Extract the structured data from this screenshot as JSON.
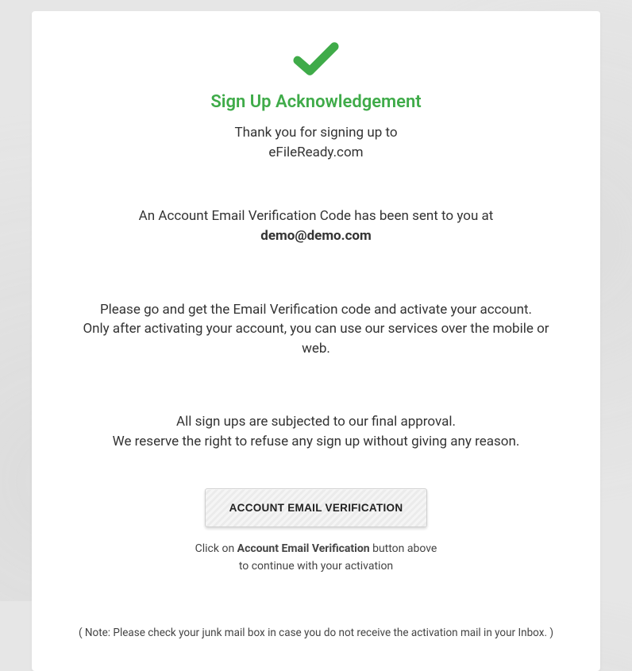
{
  "title": "Sign Up Acknowledgement",
  "subtitle_line1": "Thank you for signing up to",
  "subtitle_line2": "eFileReady.com",
  "verification_sent_text": "An Account Email Verification Code has been sent to you at",
  "email": "demo@demo.com",
  "instruction_line1": "Please go and get the Email Verification code and activate your account.",
  "instruction_line2": "Only after activating your account, you can use our services over the mobile or web.",
  "approval_line1": "All sign ups are subjected to our final approval.",
  "approval_line2": "We reserve the right to refuse any sign up without giving any reason.",
  "button_label": "ACCOUNT EMAIL VERIFICATION",
  "hint_prefix": "Click on ",
  "hint_bold": "Account Email Verification",
  "hint_suffix": " button above",
  "hint_line2": "to continue with your activation",
  "note": "( Note: Please check your junk mail box in case you do not receive the activation mail in your Inbox. )"
}
